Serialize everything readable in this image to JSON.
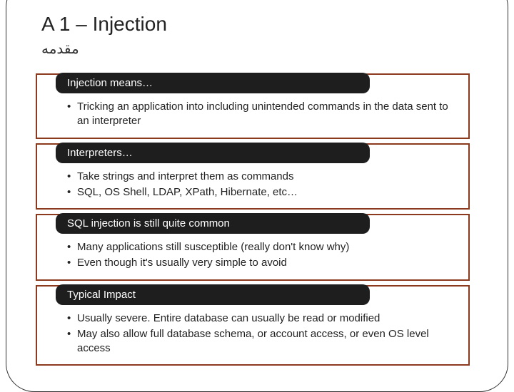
{
  "title": "A 1 – Injection",
  "subtitle": "ﻣﻘﺪﻣﻪ",
  "sections": [
    {
      "header": "Injection means…",
      "bullets": [
        "Tricking an application into including unintended commands in the data sent to an interpreter"
      ]
    },
    {
      "header": "Interpreters…",
      "bullets": [
        "Take strings and interpret them as commands",
        "SQL, OS Shell, LDAP, XPath, Hibernate, etc…"
      ]
    },
    {
      "header": "SQL injection is still quite common",
      "bullets": [
        "Many applications still susceptible (really don't know why)",
        "Even though it's usually very simple to avoid"
      ]
    },
    {
      "header": "Typical Impact",
      "bullets": [
        "Usually severe. Entire database can usually be read or modified",
        "May also allow full database schema, or account access, or even OS level access"
      ]
    }
  ]
}
